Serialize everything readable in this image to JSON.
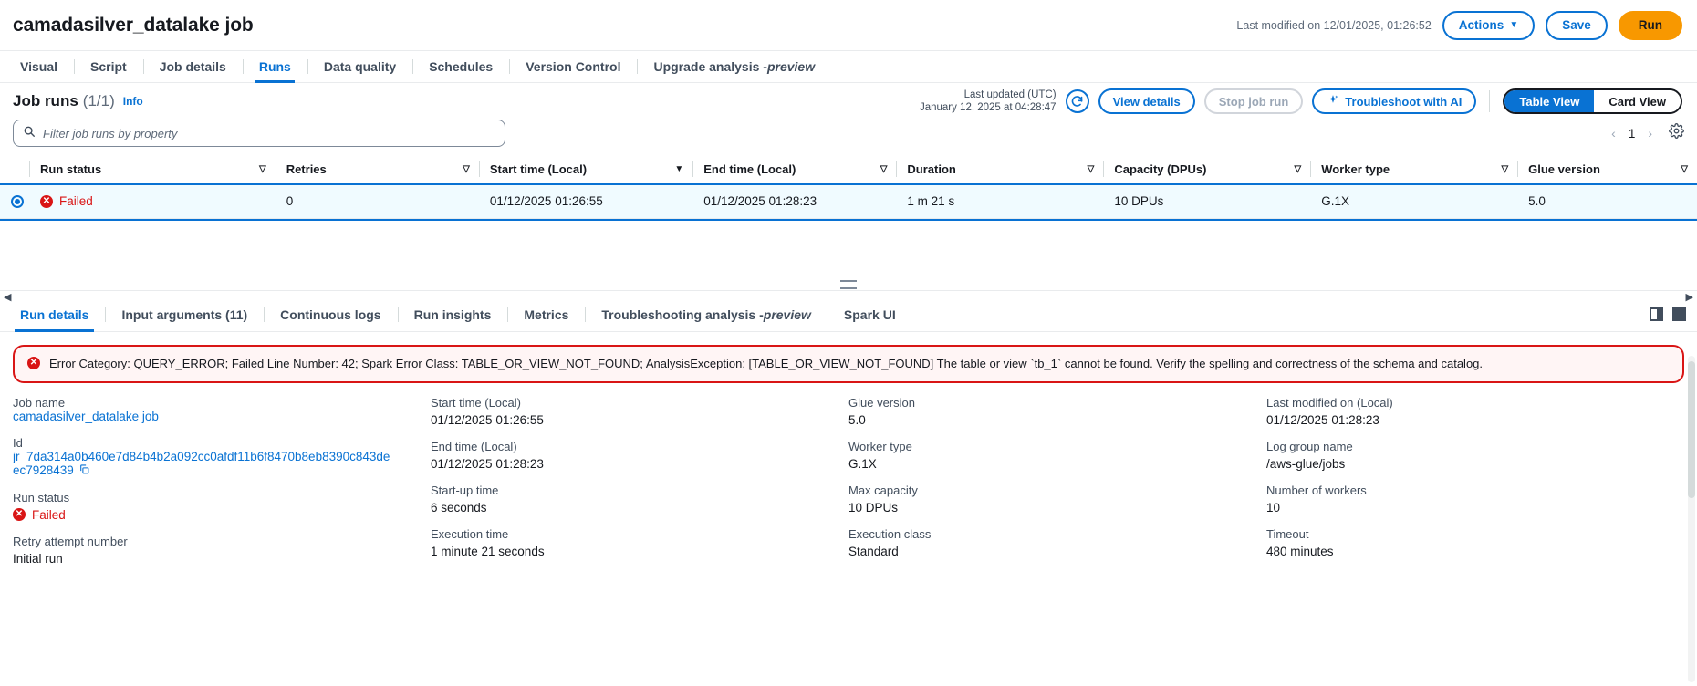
{
  "header": {
    "job_title": "camadasilver_datalake job",
    "last_modified": "Last modified on 12/01/2025, 01:26:52",
    "actions_label": "Actions",
    "actions_caret": "▼",
    "save_label": "Save",
    "run_label": "Run"
  },
  "tabs": [
    {
      "label": "Visual",
      "active": false
    },
    {
      "label": "Script",
      "active": false
    },
    {
      "label": "Job details",
      "active": false
    },
    {
      "label": "Runs",
      "active": true
    },
    {
      "label": "Data quality",
      "active": false
    },
    {
      "label": "Schedules",
      "active": false
    },
    {
      "label": "Version Control",
      "active": false
    },
    {
      "label": "Upgrade analysis - ",
      "italic": "preview",
      "active": false
    }
  ],
  "runs_section": {
    "title": "Job runs",
    "count": "(1/1)",
    "info": "Info",
    "last_updated_line1": "Last updated (UTC)",
    "last_updated_line2": "January 12, 2025 at 04:28:47",
    "refresh_icon": "refresh-icon",
    "view_details_label": "View details",
    "stop_job_run_label": "Stop job run",
    "troubleshoot_label": "Troubleshoot with AI",
    "troubleshoot_icon": "sparkle-icon",
    "table_view_label": "Table View",
    "card_view_label": "Card View",
    "active_view": "Table View"
  },
  "filter": {
    "placeholder": "Filter job runs by property",
    "value": "",
    "search_icon": "search-icon"
  },
  "pagination": {
    "prev": "‹",
    "page": "1",
    "next": "›",
    "settings_icon": "gear-icon"
  },
  "table": {
    "columns": [
      {
        "label": "Run status",
        "sort": "▽",
        "width": "14.8%"
      },
      {
        "label": "Retries",
        "sort": "▽",
        "width": "12.4%"
      },
      {
        "label": "Start time (Local)",
        "sort": "▼",
        "width": "13.2%"
      },
      {
        "label": "End time (Local)",
        "sort": "▽",
        "width": "12.2%"
      },
      {
        "label": "Duration",
        "sort": "▽",
        "width": "12.4%"
      },
      {
        "label": "Capacity (DPUs)",
        "sort": "▽",
        "width": "12.4%"
      },
      {
        "label": "Worker type",
        "sort": "▽",
        "width": "12.4%"
      },
      {
        "label": "Glue version",
        "sort": "▽",
        "width": "12.2%"
      }
    ],
    "rows": [
      {
        "selected": true,
        "run_status": "Failed",
        "retries": "0",
        "start_time": "01/12/2025 01:26:55",
        "end_time": "01/12/2025 01:28:23",
        "duration": "1 m 21 s",
        "capacity": "10 DPUs",
        "worker_type": "G.1X",
        "glue_version": "5.0"
      }
    ]
  },
  "bottom_tabs": [
    {
      "label": "Run details",
      "active": true
    },
    {
      "label": "Input arguments (11)",
      "active": false
    },
    {
      "label": "Continuous logs",
      "active": false
    },
    {
      "label": "Run insights",
      "active": false
    },
    {
      "label": "Metrics",
      "active": false
    },
    {
      "label": "Troubleshooting analysis - ",
      "italic": "preview",
      "active": false
    },
    {
      "label": "Spark UI",
      "active": false
    }
  ],
  "panel_icons": {
    "split_pane_icon": "split-pane-icon",
    "full_pane_icon": "full-pane-icon"
  },
  "error_alert": {
    "icon": "error-circle-icon",
    "message": "Error Category: QUERY_ERROR; Failed Line Number: 42; Spark Error Class: TABLE_OR_VIEW_NOT_FOUND; AnalysisException: [TABLE_OR_VIEW_NOT_FOUND] The table or view `tb_1` cannot be found. Verify the spelling and correctness of the schema and catalog."
  },
  "details": {
    "col1": [
      {
        "label": "Job name",
        "value": "camadasilver_datalake job",
        "link": true
      },
      {
        "label": "Id",
        "value": "jr_7da314a0b460e7d84b4b2a092cc0afdf11b6f8470b8eb8390c843de",
        "value2": "ec7928439",
        "link": true,
        "copy": true
      },
      {
        "label": "Run status",
        "value": "Failed",
        "status": "failed"
      },
      {
        "label": "Retry attempt number",
        "value": "Initial run"
      }
    ],
    "col2": [
      {
        "label": "Start time (Local)",
        "value": "01/12/2025 01:26:55"
      },
      {
        "label": "End time (Local)",
        "value": "01/12/2025 01:28:23"
      },
      {
        "label": "Start-up time",
        "value": "6 seconds"
      },
      {
        "label": "Execution time",
        "value": "1 minute 21 seconds"
      }
    ],
    "col3": [
      {
        "label": "Glue version",
        "value": "5.0"
      },
      {
        "label": "Worker type",
        "value": "G.1X"
      },
      {
        "label": "Max capacity",
        "value": "10 DPUs"
      },
      {
        "label": "Execution class",
        "value": "Standard"
      }
    ],
    "col4": [
      {
        "label": "Last modified on (Local)",
        "value": "01/12/2025 01:28:23"
      },
      {
        "label": "Log group name",
        "value": "/aws-glue/jobs"
      },
      {
        "label": "Number of workers",
        "value": "10"
      },
      {
        "label": "Timeout",
        "value": "480 minutes"
      }
    ]
  },
  "colors": {
    "accent_blue": "#0972d3",
    "orange": "#f89800",
    "error_red": "#d91515",
    "text": "#16191f",
    "muted": "#5f6b7a"
  }
}
